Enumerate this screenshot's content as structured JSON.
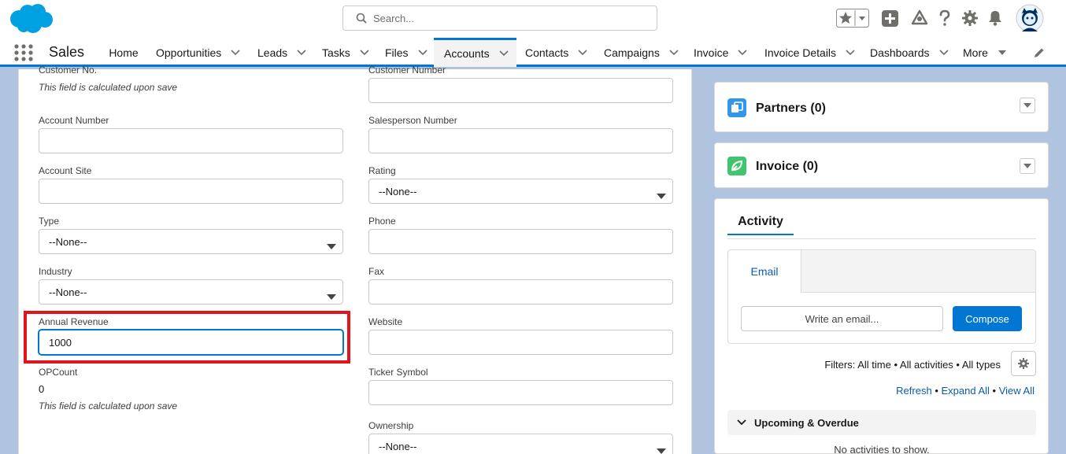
{
  "header": {
    "search_placeholder": "Search..."
  },
  "nav": {
    "app_name": "Sales",
    "items": [
      {
        "label": "Home"
      },
      {
        "label": "Opportunities"
      },
      {
        "label": "Leads"
      },
      {
        "label": "Tasks"
      },
      {
        "label": "Files"
      },
      {
        "label": "Accounts"
      },
      {
        "label": "Contacts"
      },
      {
        "label": "Campaigns"
      },
      {
        "label": "Invoice"
      },
      {
        "label": "Invoice Details"
      },
      {
        "label": "Dashboards"
      },
      {
        "label": "More"
      }
    ],
    "active": "Accounts"
  },
  "form": {
    "left": {
      "customer_no": {
        "label": "Customer No.",
        "help": "This field is calculated upon save"
      },
      "account_number": {
        "label": "Account Number",
        "value": ""
      },
      "account_site": {
        "label": "Account Site",
        "value": ""
      },
      "type": {
        "label": "Type",
        "value": "--None--"
      },
      "industry": {
        "label": "Industry",
        "value": "--None--"
      },
      "annual_revenue": {
        "label": "Annual Revenue",
        "value": "1000"
      },
      "opcount": {
        "label": "OPCount",
        "value": "0",
        "help": "This field is calculated upon save"
      }
    },
    "right": {
      "customer_number": {
        "label": "Customer Number",
        "value": ""
      },
      "salesperson_number": {
        "label": "Salesperson Number",
        "value": ""
      },
      "rating": {
        "label": "Rating",
        "value": "--None--"
      },
      "phone": {
        "label": "Phone",
        "value": ""
      },
      "fax": {
        "label": "Fax",
        "value": ""
      },
      "website": {
        "label": "Website",
        "value": ""
      },
      "ticker_symbol": {
        "label": "Ticker Symbol",
        "value": ""
      },
      "ownership": {
        "label": "Ownership",
        "value": "--None--"
      }
    }
  },
  "related": {
    "partners": {
      "title": "Partners (0)",
      "color": "#3296ed"
    },
    "invoice": {
      "title": "Invoice (0)",
      "color": "#41c46e"
    }
  },
  "activity": {
    "tab": "Activity",
    "email_tab": "Email",
    "write_placeholder": "Write an email...",
    "compose": "Compose",
    "filters": "Filters: All time • All activities • All types",
    "refresh": "Refresh",
    "expand_all": "Expand All",
    "view_all": "View All",
    "sep": " • ",
    "upcoming": "Upcoming & Overdue",
    "empty": "No activities to show."
  },
  "colors": {
    "brand": "#0176d3",
    "logo": "#00a1e0",
    "highlight": "#e3131e"
  }
}
